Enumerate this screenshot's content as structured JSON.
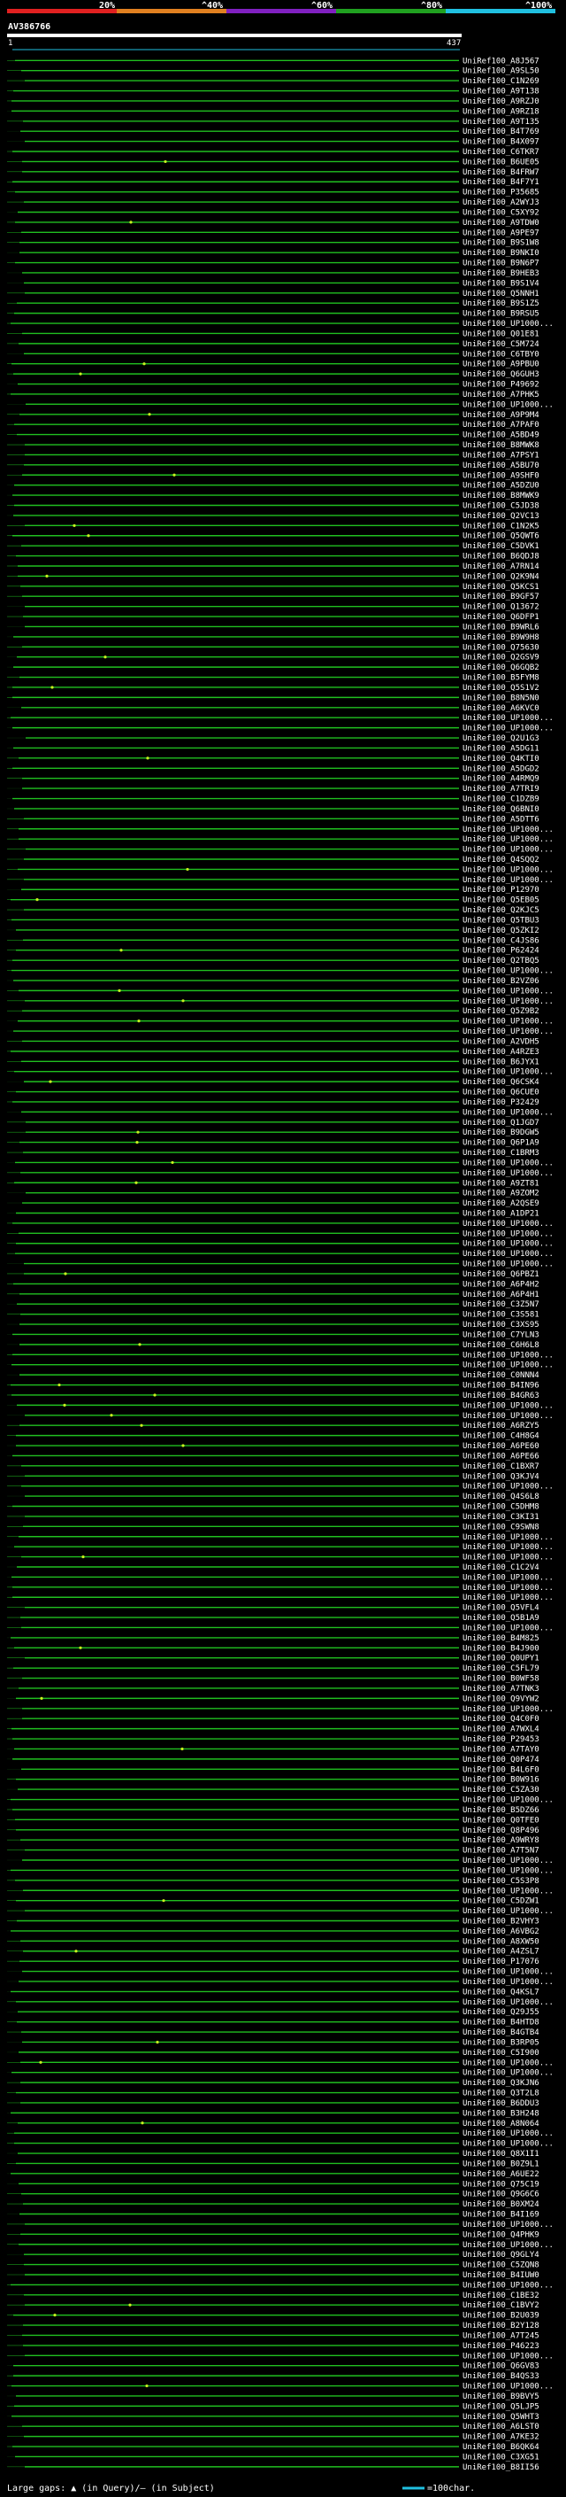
{
  "chart_data": {
    "type": "alignment-overview",
    "query_id": "AV386766",
    "query_start": "1",
    "query_end": "437",
    "identity_ticks": [
      "20%",
      "^40%",
      "^60%",
      "^80%",
      "^100%"
    ],
    "identity_colors": [
      "#e02020",
      "#e08020",
      "#8020c0",
      "#20a020",
      "#20c0e0"
    ],
    "line_color": "#20c020",
    "query_bar_color": "#20c0e0",
    "gap_mark_color": "#c8f020",
    "legend_text": "Large gaps: ▲ (in Query)/– (in Subject)",
    "scale_text": "=100char.",
    "rows": [
      "UniRef100_A8J567",
      "UniRef100_A9SL50",
      "UniRef100_C1N269",
      "UniRef100_A9T138",
      "UniRef100_A9RZJ0",
      "UniRef100_A9RZ18",
      "UniRef100_A9T135",
      "UniRef100_B4T769",
      "UniRef100_B4X097",
      "UniRef100_C6TKR7",
      "UniRef100_B6UE05",
      "UniRef100_B4FRW7",
      "UniRef100_B4F7Y1",
      "UniRef100_P35685",
      "UniRef100_A2WYJ3",
      "UniRef100_C5XY92",
      "UniRef100_A9TDW0",
      "UniRef100_A9PE97",
      "UniRef100_B9S1W8",
      "UniRef100_B9NKI0",
      "UniRef100_B9N6P7",
      "UniRef100_B9HEB3",
      "UniRef100_B9S1V4",
      "UniRef100_Q5NNH1",
      "UniRef100_B9S1Z5",
      "UniRef100_B9RSU5",
      "UniRef100_UP1000...",
      "UniRef100_Q01E81",
      "UniRef100_C5M724",
      "UniRef100_C6TBY0",
      "UniRef100_A9PBU0",
      "UniRef100_Q6GUH3",
      "UniRef100_P49692",
      "UniRef100_A7PHK5",
      "UniRef100_UP1000...",
      "UniRef100_A9P9M4",
      "UniRef100_A7PAF0",
      "UniRef100_A5BD49",
      "UniRef100_B8MWK8",
      "UniRef100_A7PSY1",
      "UniRef100_A5BU70",
      "UniRef100_A9SHF0",
      "UniRef100_A5DZU0",
      "UniRef100_B8MWK9",
      "UniRef100_C5JD38",
      "UniRef100_Q2VC13",
      "UniRef100_C1N2K5",
      "UniRef100_Q5QWT6",
      "UniRef100_C5DVK1",
      "UniRef100_B6QDJ8",
      "UniRef100_A7RN14",
      "UniRef100_Q2K9N4",
      "UniRef100_Q5KCS1",
      "UniRef100_B9GF57",
      "UniRef100_Q13672",
      "UniRef100_Q6DFP1",
      "UniRef100_B9WRL6",
      "UniRef100_B9W9H8",
      "UniRef100_Q75630",
      "UniRef100_Q2GSV9",
      "UniRef100_Q6GQB2",
      "UniRef100_B5FYM8",
      "UniRef100_Q5S1V2",
      "UniRef100_B8N5N0",
      "UniRef100_A6KVC0",
      "UniRef100_UP1000...",
      "UniRef100_UP1000...",
      "UniRef100_Q2U1G3",
      "UniRef100_A5DG11",
      "UniRef100_Q4KTI0",
      "UniRef100_A5DGD2",
      "UniRef100_A4RMQ9",
      "UniRef100_A7TRI9",
      "UniRef100_C1DZB9",
      "UniRef100_Q6BNI0",
      "UniRef100_A5DTT6",
      "UniRef100_UP1000...",
      "UniRef100_UP1000...",
      "UniRef100_UP1000...",
      "UniRef100_Q4SQQ2",
      "UniRef100_UP1000...",
      "UniRef100_UP1000...",
      "UniRef100_P12970",
      "UniRef100_Q5EB05",
      "UniRef100_Q2KJC5",
      "UniRef100_Q5TBU3",
      "UniRef100_Q5ZKI2",
      "UniRef100_C4JS86",
      "UniRef100_P62424",
      "UniRef100_Q2TBQ5",
      "UniRef100_UP1000...",
      "UniRef100_B2VZ06",
      "UniRef100_UP1000...",
      "UniRef100_UP1000...",
      "UniRef100_Q5Z9B2",
      "UniRef100_UP1000...",
      "UniRef100_UP1000...",
      "UniRef100_A2VDH5",
      "UniRef100_A4RZE3",
      "UniRef100_B6JYX1",
      "UniRef100_UP1000...",
      "UniRef100_Q6CSK4",
      "UniRef100_Q6CUE0",
      "UniRef100_P32429",
      "UniRef100_UP1000...",
      "UniRef100_Q1JGD7",
      "UniRef100_B9DGW5",
      "UniRef100_Q6P1A9",
      "UniRef100_C1BRM3",
      "UniRef100_UP1000...",
      "UniRef100_UP1000...",
      "UniRef100_A9ZT81",
      "UniRef100_A9ZOM2",
      "UniRef100_A2QSE9",
      "UniRef100_A1DP21",
      "UniRef100_UP1000...",
      "UniRef100_UP1000...",
      "UniRef100_UP1000...",
      "UniRef100_UP1000...",
      "UniRef100_UP1000...",
      "UniRef100_Q6PBZ1",
      "UniRef100_A6P4H2",
      "UniRef100_A6P4H1",
      "UniRef100_C3Z5N7",
      "UniRef100_C3S581",
      "UniRef100_C3XS95",
      "UniRef100_C7YLN3",
      "UniRef100_C6H6L8",
      "UniRef100_UP1000...",
      "UniRef100_UP1000...",
      "UniRef100_C0NNN4",
      "UniRef100_B4IN96",
      "UniRef100_B4GR63",
      "UniRef100_UP1000...",
      "UniRef100_UP1000...",
      "UniRef100_A6RZY5",
      "UniRef100_C4H8G4",
      "UniRef100_A6PE60",
      "UniRef100_A6PE66",
      "UniRef100_C1BXR7",
      "UniRef100_Q3KJV4",
      "UniRef100_UP1000...",
      "UniRef100_Q4S6L8",
      "UniRef100_C5DHM8",
      "UniRef100_C3KI31",
      "UniRef100_C9SWN8",
      "UniRef100_UP1000...",
      "UniRef100_UP1000...",
      "UniRef100_UP1000...",
      "UniRef100_C1C2V4",
      "UniRef100_UP1000...",
      "UniRef100_UP1000...",
      "UniRef100_UP1000...",
      "UniRef100_Q5VFL4",
      "UniRef100_Q5B1A9",
      "UniRef100_UP1000...",
      "UniRef100_B4M825",
      "UniRef100_B4J900",
      "UniRef100_Q0UPY1",
      "UniRef100_C5FL79",
      "UniRef100_B0WF58",
      "UniRef100_A7TNK3",
      "UniRef100_Q9VYW2",
      "UniRef100_UP1000...",
      "UniRef100_Q4C0F0",
      "UniRef100_A7WXL4",
      "UniRef100_P29453",
      "UniRef100_A7TAY0",
      "UniRef100_Q0P474",
      "UniRef100_B4L6F0",
      "UniRef100_B0W916",
      "UniRef100_C5ZA30",
      "UniRef100_UP1000...",
      "UniRef100_B5DZ66",
      "UniRef100_Q0TFE0",
      "UniRef100_Q8P496",
      "UniRef100_A9WRY8",
      "UniRef100_A7T5N7",
      "UniRef100_UP1000...",
      "UniRef100_UP1000...",
      "UniRef100_C5S3P8",
      "UniRef100_UP1000...",
      "UniRef100_C5DZW1",
      "UniRef100_UP1000...",
      "UniRef100_B2VHY3",
      "UniRef100_A6VBG2",
      "UniRef100_A8XW50",
      "UniRef100_A4ZSL7",
      "UniRef100_P17076",
      "UniRef100_UP1000...",
      "UniRef100_UP1000...",
      "UniRef100_Q4KSL7",
      "UniRef100_UP1000...",
      "UniRef100_Q29J55",
      "UniRef100_B4HTD8",
      "UniRef100_B4GTB4",
      "UniRef100_B3RP05",
      "UniRef100_C5I900",
      "UniRef100_UP1000...",
      "UniRef100_UP1000...",
      "UniRef100_Q3KJN6",
      "UniRef100_Q3T2L8",
      "UniRef100_B6DDU3",
      "UniRef100_B3H248",
      "UniRef100_A8N064",
      "UniRef100_UP1000...",
      "UniRef100_UP1000...",
      "UniRef100_Q8X1I1",
      "UniRef100_B0Z9L1",
      "UniRef100_A6UE22",
      "UniRef100_Q75C19",
      "UniRef100_Q9G6C6",
      "UniRef100_B0XM24",
      "UniRef100_B4I169",
      "UniRef100_UP1000...",
      "UniRef100_Q4PHK9",
      "UniRef100_UP1000...",
      "UniRef100_Q9GLY4",
      "UniRef100_C5ZQN8",
      "UniRef100_B4IUW0",
      "UniRef100_UP1000...",
      "UniRef100_C1BE32",
      "UniRef100_C1BVY2",
      "UniRef100_B2U039",
      "UniRef100_B2Y128",
      "UniRef100_A7T245",
      "UniRef100_P46223",
      "UniRef100_UP1000...",
      "UniRef100_Q6GV83",
      "UniRef100_B4QS33",
      "UniRef100_UP1000...",
      "UniRef100_B9BVY5",
      "UniRef100_Q5LJP5",
      "UniRef100_Q5WHT3",
      "UniRef100_A6LST0",
      "UniRef100_A7KE32",
      "UniRef100_B6QK64",
      "UniRef100_C3XG51",
      "UniRef100_B8II56"
    ]
  }
}
